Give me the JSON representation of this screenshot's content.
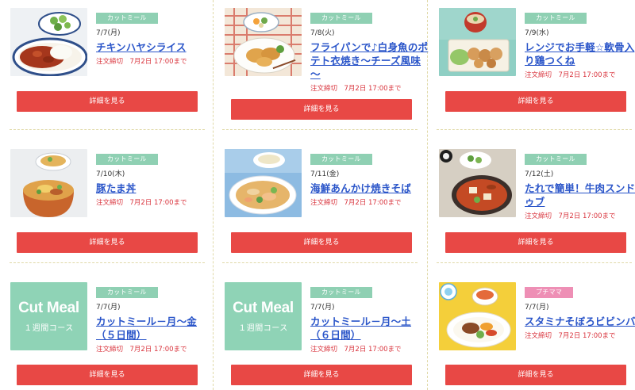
{
  "colors": {
    "button": "#e84845",
    "tag_green": "#8fd0b3",
    "tag_pink": "#ee8fb5",
    "title_link": "#2a55c9",
    "deadline": "#d9343d",
    "divider": "#e0d9a8"
  },
  "button_label": "詳細を見る",
  "cards": [
    {
      "tag": "カットミール",
      "date": "7/7(月)",
      "title": "チキンハヤシライス",
      "deadline": "注文締切　7月2日 17:00まで",
      "image": "chicken-hayashi-rice-photo"
    },
    {
      "tag": "カットミール",
      "date": "7/8(火)",
      "title": "フライパンで♪白身魚のポテト衣焼き～チーズ風味～",
      "deadline": "注文締切　7月2日 17:00まで",
      "image": "white-fish-potato-photo"
    },
    {
      "tag": "カットミール",
      "date": "7/9(水)",
      "title": "レンジでお手軽☆軟骨入り鶏つくね",
      "deadline": "注文締切　7月2日 17:00まで",
      "image": "chicken-tsukune-photo"
    },
    {
      "tag": "カットミール",
      "date": "7/10(木)",
      "title": "豚たま丼",
      "deadline": "注文締切　7月2日 17:00まで",
      "image": "pork-egg-bowl-photo"
    },
    {
      "tag": "カットミール",
      "date": "7/11(金)",
      "title": "海鮮あんかけ焼きそば",
      "deadline": "注文締切　7月2日 17:00まで",
      "image": "seafood-yakisoba-photo"
    },
    {
      "tag": "カットミール",
      "date": "7/12(土)",
      "title": "たれで簡単！牛肉スンドゥブ",
      "deadline": "注文締切　7月2日 17:00まで",
      "image": "beef-sundubu-photo"
    },
    {
      "tag": "カットミール",
      "date": "7/7(月)",
      "title": "カットミール－月～金（５日間）",
      "deadline": "注文締切　7月2日 17:00まで",
      "image": "cut-meal-logo",
      "logo_line1": "Cut Meal",
      "logo_line2": "１週間コース"
    },
    {
      "tag": "カットミール",
      "date": "7/7(月)",
      "title": "カットミール－月～土（６日間）",
      "deadline": "注文締切　7月2日 17:00まで",
      "image": "cut-meal-logo",
      "logo_line1": "Cut Meal",
      "logo_line2": "１週間コース"
    },
    {
      "tag": "プチママ",
      "date": "7/7(月)",
      "title": "スタミナそぼろビビンバ",
      "deadline": "注文締切　7月2日 17:00まで",
      "image": "stamina-bibimbap-photo"
    }
  ]
}
